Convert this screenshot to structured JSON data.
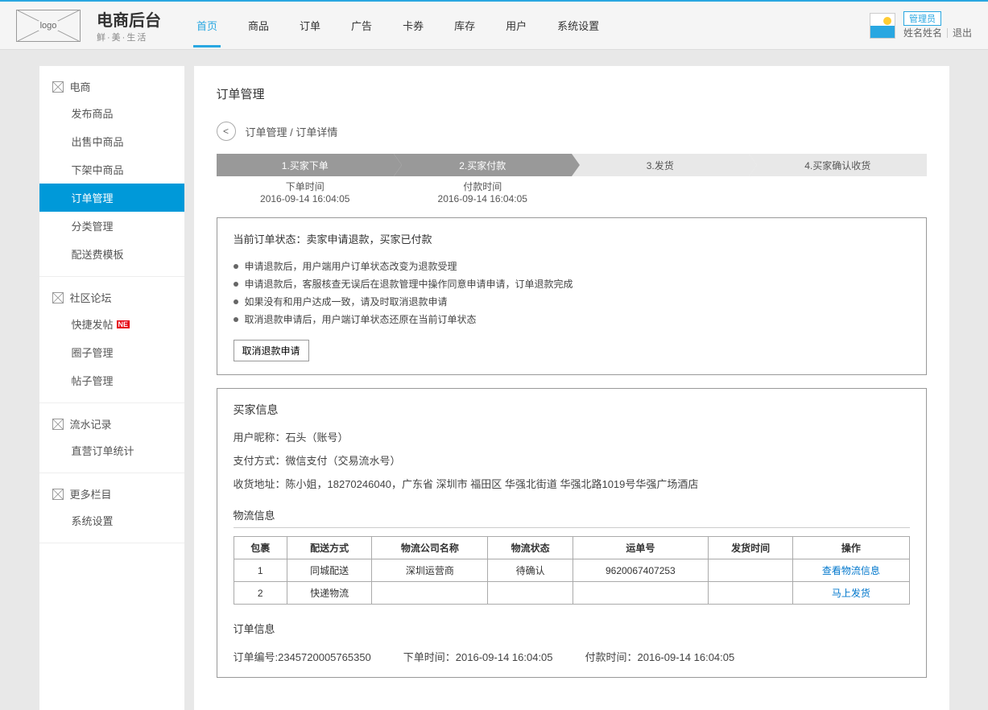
{
  "header": {
    "logo_text": "logo",
    "brand_title": "电商后台",
    "brand_sub": "鲜·美·生活",
    "nav": [
      "首页",
      "商品",
      "订单",
      "广告",
      "卡券",
      "库存",
      "用户",
      "系统设置"
    ],
    "active_nav_index": 0,
    "admin_badge": "管理员",
    "username": "姓名姓名",
    "logout": "退出"
  },
  "sidebar": [
    {
      "title": "电商",
      "items": [
        "发布商品",
        "出售中商品",
        "下架中商品",
        "订单管理",
        "分类管理",
        "配送费模板"
      ],
      "active_index": 3
    },
    {
      "title": "社区论坛",
      "items": [
        "快捷发帖",
        "圈子管理",
        "帖子管理"
      ],
      "new_index": 0
    },
    {
      "title": "流水记录",
      "items": [
        "直营订单统计"
      ]
    },
    {
      "title": "更多栏目",
      "items": [
        "系统设置"
      ]
    }
  ],
  "main": {
    "page_title": "订单管理",
    "back_symbol": "<",
    "breadcrumb": "订单管理 / 订单详情",
    "steps": [
      {
        "label": "1.买家下单",
        "done": true,
        "time_label": "下单时间",
        "time": "2016-09-14 16:04:05"
      },
      {
        "label": "2.买家付款",
        "done": true,
        "time_label": "付款时间",
        "time": "2016-09-14 16:04:05"
      },
      {
        "label": "3.发货",
        "done": false
      },
      {
        "label": "4.买家确认收货",
        "done": false
      }
    ],
    "status_panel": {
      "status": "当前订单状态：卖家申请退款，买家已付款",
      "notes": [
        "申请退款后，用户端用户订单状态改变为退款受理",
        "申请退款后，客服核查无误后在退款管理中操作同意申请申请，订单退款完成",
        "如果没有和用户达成一致，请及时取消退款申请",
        "取消退款申请后，用户端订单状态还原在当前订单状态"
      ],
      "cancel_btn": "取消退款申请"
    },
    "buyer": {
      "title": "买家信息",
      "nickname": "用户昵称：石头（账号）",
      "payment": "支付方式：微信支付（交易流水号）",
      "address": "收货地址：陈小姐，18270246040，广东省 深圳市 福田区 华强北街道 华强北路1019号华强广场酒店"
    },
    "logistics": {
      "title": "物流信息",
      "headers": [
        "包裹",
        "配送方式",
        "物流公司名称",
        "物流状态",
        "运单号",
        "发货时间",
        "操作"
      ],
      "rows": [
        {
          "pkg": "1",
          "method": "同城配送",
          "company": "深圳运营商",
          "status": "待确认",
          "tracking": "9620067407253",
          "ship_time": "",
          "action": "查看物流信息"
        },
        {
          "pkg": "2",
          "method": "快递物流",
          "company": "",
          "status": "",
          "tracking": "",
          "ship_time": "",
          "action": "马上发货"
        }
      ]
    },
    "order_info": {
      "title": "订单信息",
      "order_no": "订单编号:2345720005765350",
      "order_time": "下单时间：2016-09-14 16:04:05",
      "pay_time": "付款时间：2016-09-14 16:04:05"
    }
  },
  "new_label": "NE"
}
